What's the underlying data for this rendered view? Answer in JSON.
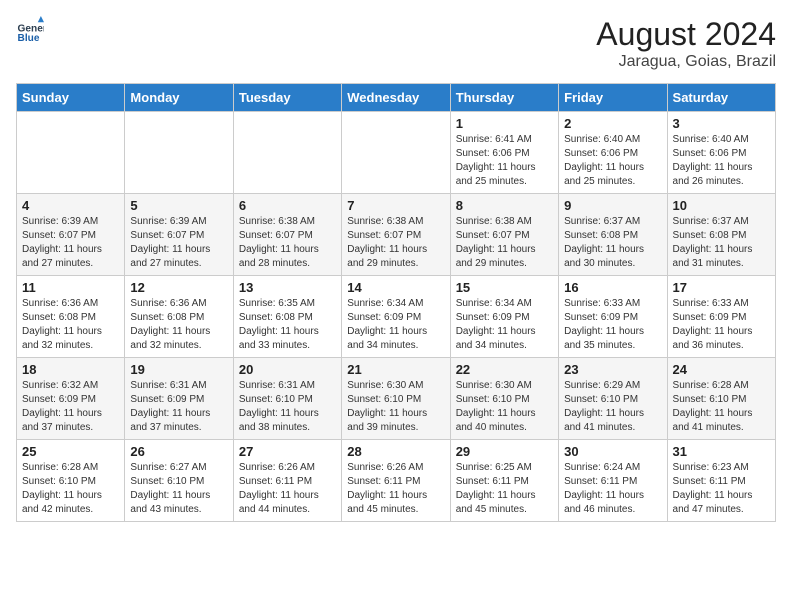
{
  "header": {
    "logo_line1": "General",
    "logo_line2": "Blue",
    "title": "August 2024",
    "subtitle": "Jaragua, Goias, Brazil"
  },
  "days_of_week": [
    "Sunday",
    "Monday",
    "Tuesday",
    "Wednesday",
    "Thursday",
    "Friday",
    "Saturday"
  ],
  "weeks": [
    [
      {
        "day": "",
        "info": ""
      },
      {
        "day": "",
        "info": ""
      },
      {
        "day": "",
        "info": ""
      },
      {
        "day": "",
        "info": ""
      },
      {
        "day": "1",
        "info": "Sunrise: 6:41 AM\nSunset: 6:06 PM\nDaylight: 11 hours and 25 minutes."
      },
      {
        "day": "2",
        "info": "Sunrise: 6:40 AM\nSunset: 6:06 PM\nDaylight: 11 hours and 25 minutes."
      },
      {
        "day": "3",
        "info": "Sunrise: 6:40 AM\nSunset: 6:06 PM\nDaylight: 11 hours and 26 minutes."
      }
    ],
    [
      {
        "day": "4",
        "info": "Sunrise: 6:39 AM\nSunset: 6:07 PM\nDaylight: 11 hours and 27 minutes."
      },
      {
        "day": "5",
        "info": "Sunrise: 6:39 AM\nSunset: 6:07 PM\nDaylight: 11 hours and 27 minutes."
      },
      {
        "day": "6",
        "info": "Sunrise: 6:38 AM\nSunset: 6:07 PM\nDaylight: 11 hours and 28 minutes."
      },
      {
        "day": "7",
        "info": "Sunrise: 6:38 AM\nSunset: 6:07 PM\nDaylight: 11 hours and 29 minutes."
      },
      {
        "day": "8",
        "info": "Sunrise: 6:38 AM\nSunset: 6:07 PM\nDaylight: 11 hours and 29 minutes."
      },
      {
        "day": "9",
        "info": "Sunrise: 6:37 AM\nSunset: 6:08 PM\nDaylight: 11 hours and 30 minutes."
      },
      {
        "day": "10",
        "info": "Sunrise: 6:37 AM\nSunset: 6:08 PM\nDaylight: 11 hours and 31 minutes."
      }
    ],
    [
      {
        "day": "11",
        "info": "Sunrise: 6:36 AM\nSunset: 6:08 PM\nDaylight: 11 hours and 32 minutes."
      },
      {
        "day": "12",
        "info": "Sunrise: 6:36 AM\nSunset: 6:08 PM\nDaylight: 11 hours and 32 minutes."
      },
      {
        "day": "13",
        "info": "Sunrise: 6:35 AM\nSunset: 6:08 PM\nDaylight: 11 hours and 33 minutes."
      },
      {
        "day": "14",
        "info": "Sunrise: 6:34 AM\nSunset: 6:09 PM\nDaylight: 11 hours and 34 minutes."
      },
      {
        "day": "15",
        "info": "Sunrise: 6:34 AM\nSunset: 6:09 PM\nDaylight: 11 hours and 34 minutes."
      },
      {
        "day": "16",
        "info": "Sunrise: 6:33 AM\nSunset: 6:09 PM\nDaylight: 11 hours and 35 minutes."
      },
      {
        "day": "17",
        "info": "Sunrise: 6:33 AM\nSunset: 6:09 PM\nDaylight: 11 hours and 36 minutes."
      }
    ],
    [
      {
        "day": "18",
        "info": "Sunrise: 6:32 AM\nSunset: 6:09 PM\nDaylight: 11 hours and 37 minutes."
      },
      {
        "day": "19",
        "info": "Sunrise: 6:31 AM\nSunset: 6:09 PM\nDaylight: 11 hours and 37 minutes."
      },
      {
        "day": "20",
        "info": "Sunrise: 6:31 AM\nSunset: 6:10 PM\nDaylight: 11 hours and 38 minutes."
      },
      {
        "day": "21",
        "info": "Sunrise: 6:30 AM\nSunset: 6:10 PM\nDaylight: 11 hours and 39 minutes."
      },
      {
        "day": "22",
        "info": "Sunrise: 6:30 AM\nSunset: 6:10 PM\nDaylight: 11 hours and 40 minutes."
      },
      {
        "day": "23",
        "info": "Sunrise: 6:29 AM\nSunset: 6:10 PM\nDaylight: 11 hours and 41 minutes."
      },
      {
        "day": "24",
        "info": "Sunrise: 6:28 AM\nSunset: 6:10 PM\nDaylight: 11 hours and 41 minutes."
      }
    ],
    [
      {
        "day": "25",
        "info": "Sunrise: 6:28 AM\nSunset: 6:10 PM\nDaylight: 11 hours and 42 minutes."
      },
      {
        "day": "26",
        "info": "Sunrise: 6:27 AM\nSunset: 6:10 PM\nDaylight: 11 hours and 43 minutes."
      },
      {
        "day": "27",
        "info": "Sunrise: 6:26 AM\nSunset: 6:11 PM\nDaylight: 11 hours and 44 minutes."
      },
      {
        "day": "28",
        "info": "Sunrise: 6:26 AM\nSunset: 6:11 PM\nDaylight: 11 hours and 45 minutes."
      },
      {
        "day": "29",
        "info": "Sunrise: 6:25 AM\nSunset: 6:11 PM\nDaylight: 11 hours and 45 minutes."
      },
      {
        "day": "30",
        "info": "Sunrise: 6:24 AM\nSunset: 6:11 PM\nDaylight: 11 hours and 46 minutes."
      },
      {
        "day": "31",
        "info": "Sunrise: 6:23 AM\nSunset: 6:11 PM\nDaylight: 11 hours and 47 minutes."
      }
    ]
  ]
}
